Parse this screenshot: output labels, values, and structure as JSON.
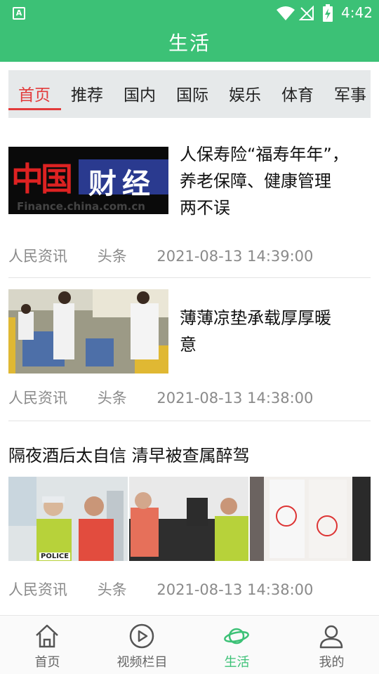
{
  "status_bar": {
    "time": "4:42",
    "app_icon_label": "A"
  },
  "header": {
    "title": "生活"
  },
  "tabs": [
    {
      "label": "首页",
      "active": true
    },
    {
      "label": "推荐"
    },
    {
      "label": "国内"
    },
    {
      "label": "国际"
    },
    {
      "label": "娱乐"
    },
    {
      "label": "体育"
    },
    {
      "label": "军事"
    }
  ],
  "articles": [
    {
      "title": "人保寿险“福寿年年”，养老保障、健康管理两不误",
      "title_lines": [
        "人保寿险“福寿年年”，",
        "养老保障、健康管理",
        "两不误"
      ],
      "source": "人民资讯",
      "category": "头条",
      "time": "2021-08-13 14:39:00",
      "thumb_text": {
        "logo_cn": "中国",
        "logo_sub": "财经",
        "url": "Finance.china.com.cn"
      }
    },
    {
      "title": "薄薄凉垫承载厚厚暖意",
      "title_lines": [
        "薄薄凉垫承载厚厚暖",
        "意"
      ],
      "source": "人民资讯",
      "category": "头条",
      "time": "2021-08-13 14:38:00"
    },
    {
      "title": "隔夜酒后太自信 清早被查属醉驾",
      "source": "人民资讯",
      "category": "头条",
      "time": "2021-08-13 14:38:00",
      "thumb_text": {
        "police": "POLICE"
      }
    }
  ],
  "bottom_nav": [
    {
      "label": "首页",
      "icon": "home-icon"
    },
    {
      "label": "视频栏目",
      "icon": "video-icon"
    },
    {
      "label": "生活",
      "icon": "planet-icon",
      "active": true
    },
    {
      "label": "我的",
      "icon": "user-icon"
    }
  ],
  "colors": {
    "accent": "#3cc176",
    "tab_active": "#e23b3b",
    "meta_text": "#8a8a8a"
  }
}
